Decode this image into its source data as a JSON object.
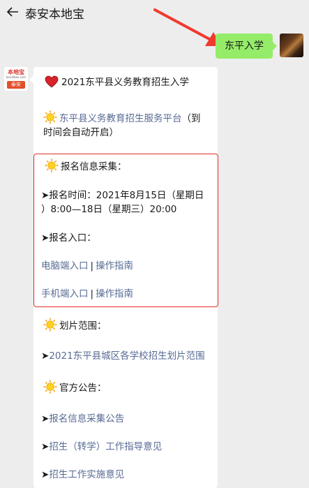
{
  "header": {
    "title": "泰安本地宝"
  },
  "self_message": {
    "text": "东平入学"
  },
  "bot_avatar": {
    "logo_top": "本地宝",
    "logo_mid": "bendibao.com",
    "logo_bottom": "泰安"
  },
  "card": {
    "title": "2021东平县义务教育招生入学",
    "platform_link": "东平县义务教育招生服务平台",
    "platform_note_1": "（到",
    "platform_note_2": "时间会自动开启）",
    "collect_heading": "报名信息采集：",
    "time_line_1": "➤报名时间：2021年8月15日（星期日",
    "time_line_2": "）8:00—18日（星期三）20:00",
    "entry_heading": "➤报名入口：",
    "pc_entry": "电脑端入口",
    "pc_guide": "操作指南",
    "mobile_entry": "手机端入口",
    "mobile_guide": "操作指南",
    "separator": "|",
    "zone_heading": "划片范围：",
    "zone_arrow": "➤",
    "zone_link": "2021东平县城区各学校招生划片范围",
    "notice_heading": "官方公告：",
    "notice_arrow_1": "➤",
    "notice_link_1": "报名信息采集公告",
    "notice_arrow_2": "➤",
    "notice_link_2": "招生（转学）工作指导意见",
    "notice_arrow_3": "➤",
    "notice_link_3": "招生工作实施意见"
  },
  "colors": {
    "link": "#576b95",
    "bubble_self": "#95ec69",
    "highlight_border": "#e02e24",
    "arrow": "#f03a2e"
  }
}
